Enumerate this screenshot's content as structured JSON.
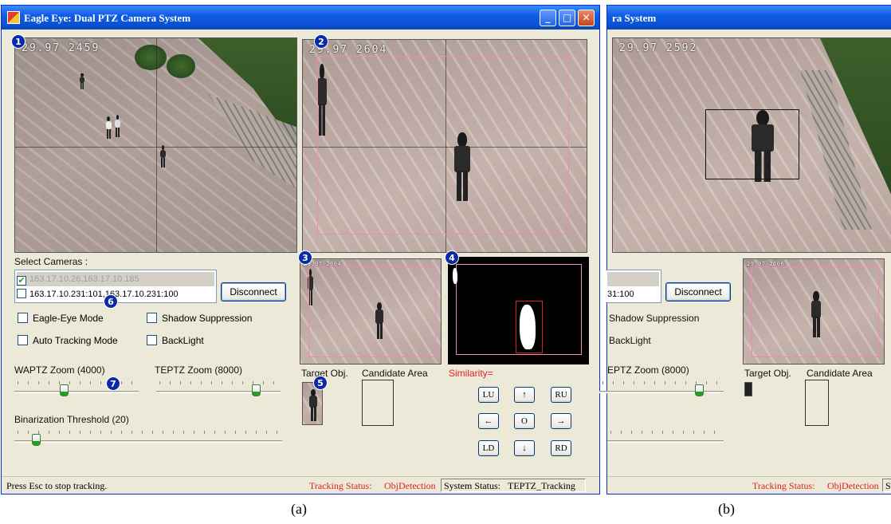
{
  "panel_a": {
    "window_title": "Eagle Eye: Dual PTZ Camera System",
    "window_buttons": {
      "minimize": "_",
      "maximize": "□",
      "close": "✕"
    },
    "badges": [
      "1",
      "2",
      "3",
      "4",
      "5",
      "6",
      "7"
    ],
    "cam1_osd": "29.97  2459",
    "cam2_osd": "29.97  2604",
    "cam3_osd": "29.97  2604",
    "select_cameras_label": "Select Cameras :",
    "camera_list": [
      {
        "label": "163.17.10.26,163.17.10.185",
        "checked": true
      },
      {
        "label": "163.17.10.231:101,163.17.10.231:100",
        "checked": false
      }
    ],
    "disconnect_label": "Disconnect",
    "checkboxes": {
      "eagle_eye_mode": "Eagle-Eye Mode",
      "shadow_suppression": "Shadow Suppression",
      "auto_tracking_mode": "Auto Tracking Mode",
      "backlight": "BackLight"
    },
    "waptz_zoom_label": "WAPTZ Zoom (4000)",
    "teptz_zoom_label": "TEPTZ Zoom (8000)",
    "binarization_label": "Binarization Threshold (20)",
    "waptz_zoom_value": 4000,
    "waptz_slider_fraction": 0.4,
    "teptz_slider_fraction": 0.8,
    "binarization_slider_fraction": 0.08,
    "target_obj_label": "Target Obj.",
    "candidate_area_label": "Candidate Area",
    "similarity_label": "Similarity=",
    "ptz_buttons": {
      "lu": "LU",
      "up": "↑",
      "ru": "RU",
      "left": "←",
      "home": "O",
      "right": "→",
      "ld": "LD",
      "down": "↓",
      "rd": "RD"
    },
    "status_left": "Press Esc to stop tracking.",
    "tracking_status_label": "Tracking Status:",
    "tracking_status_value": "ObjDetection",
    "system_status_label": "System Status:",
    "system_status_value": "TEPTZ_Tracking"
  },
  "panel_b": {
    "window_title_partial": "ra System",
    "cam_osd": "29.97  2592",
    "cam_small_osd": "29.97  2606",
    "camera_list_partial": "31:100",
    "disconnect_label": "Disconnect",
    "shadow_suppression": "Shadow Suppression",
    "backlight": "BackLight",
    "teptz_zoom_label": "EPTZ Zoom (8000)",
    "teptz_slider_fraction": 0.8,
    "target_obj_label": "Target Obj.",
    "candidate_area_label": "Candidate Area",
    "tracking_status_label": "Tracking Status:",
    "tracking_status_value": "ObjDetection",
    "system_status_partial": "S"
  },
  "captions": {
    "a": "(a)",
    "b": "(b)"
  },
  "colors": {
    "titlebar": "#0a4fd0",
    "window_bg": "#ece9d8",
    "status_red": "#e02020",
    "badge": "#0b2aa8"
  }
}
